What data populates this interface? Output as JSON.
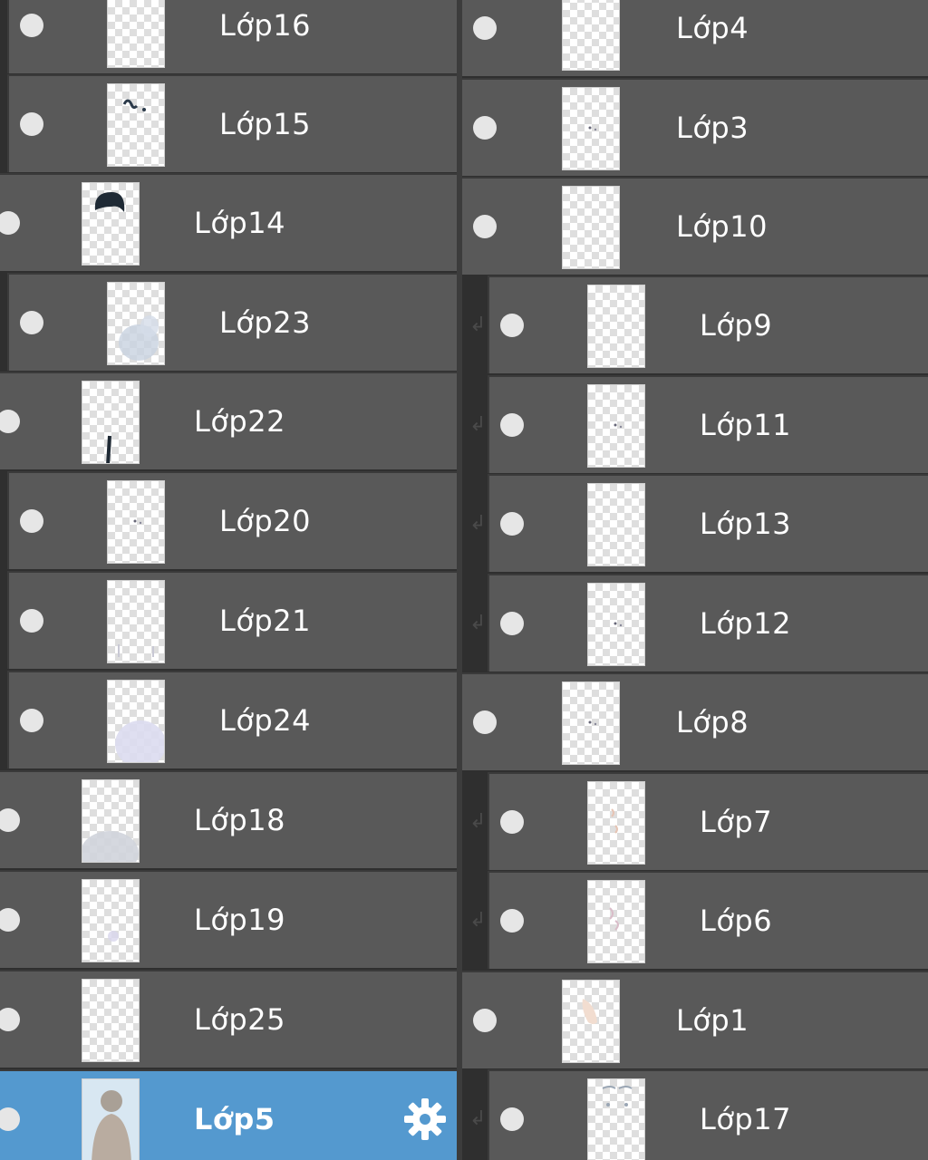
{
  "left_layers": [
    {
      "label": "Lớp16",
      "indent": true,
      "selected": false,
      "thumb_content": "faint-sketch"
    },
    {
      "label": "Lớp15",
      "indent": true,
      "selected": false,
      "thumb_content": "small-dark-strokes"
    },
    {
      "label": "Lớp14",
      "indent": false,
      "selected": false,
      "thumb_content": "dark-hair-blob"
    },
    {
      "label": "Lớp23",
      "indent": true,
      "selected": false,
      "thumb_content": "pale-blue-shading"
    },
    {
      "label": "Lớp22",
      "indent": false,
      "selected": false,
      "thumb_content": "dark-vertical-stroke"
    },
    {
      "label": "Lớp20",
      "indent": true,
      "selected": false,
      "thumb_content": "tiny-dots"
    },
    {
      "label": "Lớp21",
      "indent": true,
      "selected": false,
      "thumb_content": "faint-lines"
    },
    {
      "label": "Lớp24",
      "indent": true,
      "selected": false,
      "thumb_content": "pale-lilac-shading"
    },
    {
      "label": "Lớp18",
      "indent": false,
      "selected": false,
      "thumb_content": "grey-shading"
    },
    {
      "label": "Lớp19",
      "indent": false,
      "selected": false,
      "thumb_content": "faint-lilac-mark"
    },
    {
      "label": "Lớp25",
      "indent": false,
      "selected": false,
      "thumb_content": "empty"
    },
    {
      "label": "Lớp5",
      "indent": false,
      "selected": true,
      "thumb_content": "figure-silhouette",
      "has_settings_icon": true
    }
  ],
  "right_layers": [
    {
      "label": "Lớp4",
      "indent": false,
      "clipped": false,
      "thumb_content": "empty"
    },
    {
      "label": "Lớp3",
      "indent": false,
      "clipped": false,
      "thumb_content": "tiny-dots"
    },
    {
      "label": "Lớp10",
      "indent": false,
      "clipped": false,
      "thumb_content": "empty"
    },
    {
      "label": "Lớp9",
      "indent": true,
      "clipped": true,
      "thumb_content": "empty"
    },
    {
      "label": "Lớp11",
      "indent": true,
      "clipped": true,
      "thumb_content": "tiny-dots"
    },
    {
      "label": "Lớp13",
      "indent": true,
      "clipped": true,
      "thumb_content": "empty"
    },
    {
      "label": "Lớp12",
      "indent": true,
      "clipped": true,
      "thumb_content": "tiny-dots"
    },
    {
      "label": "Lớp8",
      "indent": false,
      "clipped": false,
      "thumb_content": "tiny-dots"
    },
    {
      "label": "Lớp7",
      "indent": true,
      "clipped": true,
      "thumb_content": "faint-peach-marks"
    },
    {
      "label": "Lớp6",
      "indent": true,
      "clipped": true,
      "thumb_content": "faint-pink-marks"
    },
    {
      "label": "Lớp1",
      "indent": false,
      "clipped": false,
      "thumb_content": "skin-tone-mark"
    },
    {
      "label": "Lớp17",
      "indent": true,
      "clipped": true,
      "thumb_content": "faint-face-lines"
    }
  ],
  "icons": {
    "visibility": "eye-icon",
    "clipping": "clipping-arrow-icon",
    "settings": "gear-icon"
  },
  "colors": {
    "row_bg": "#595959",
    "selected_bg": "#5499cf",
    "text": "#ffffff",
    "eye_dot": "#e6e6e6"
  }
}
